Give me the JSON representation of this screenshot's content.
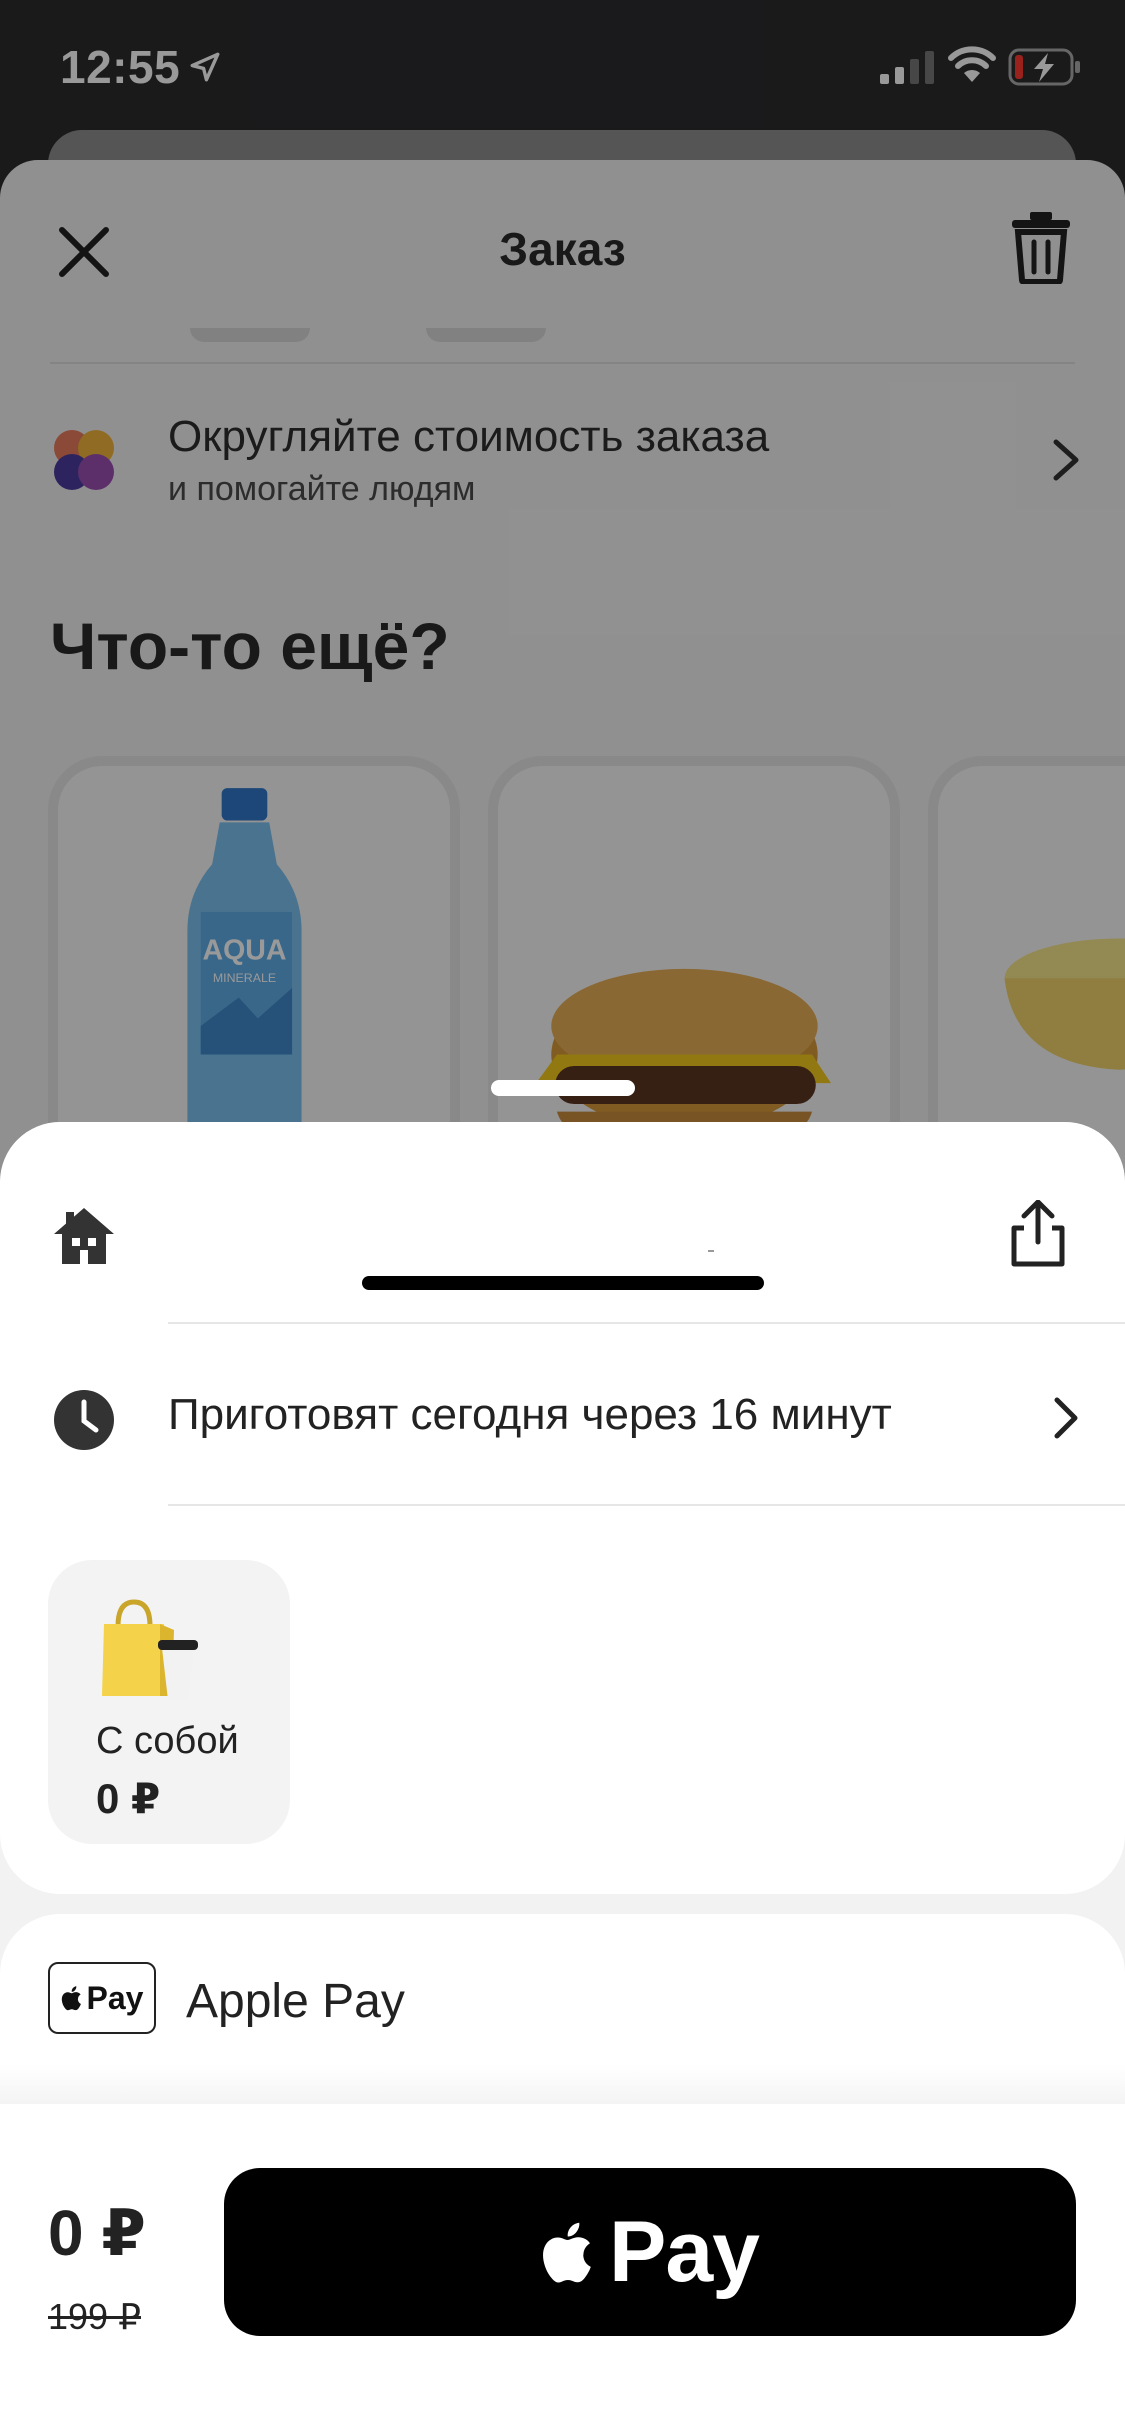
{
  "status_bar": {
    "time": "12:55"
  },
  "order_sheet": {
    "title": "Заказ",
    "charity": {
      "title": "Округляйте стоимость заказа",
      "subtitle": "и помогайте людям"
    },
    "upsell": {
      "title": "Что-то ещё?",
      "items": [
        {
          "name": "water-bottle"
        },
        {
          "name": "cheeseburger"
        },
        {
          "name": "sauce"
        }
      ]
    }
  },
  "delivery": {
    "prepare_time": "Приготовят сегодня через 16 минут",
    "takeaway": {
      "label": "С собой",
      "price": "0 ₽"
    }
  },
  "payment": {
    "badge_text": "Pay",
    "method_label": "Apple Pay"
  },
  "footer": {
    "total": "0 ₽",
    "old_total": "199 ₽",
    "pay_button_text": "Pay"
  },
  "colors": {
    "overlay": "#000000",
    "pay_button": "#000000",
    "bag_yellow": "#f4d34a"
  }
}
